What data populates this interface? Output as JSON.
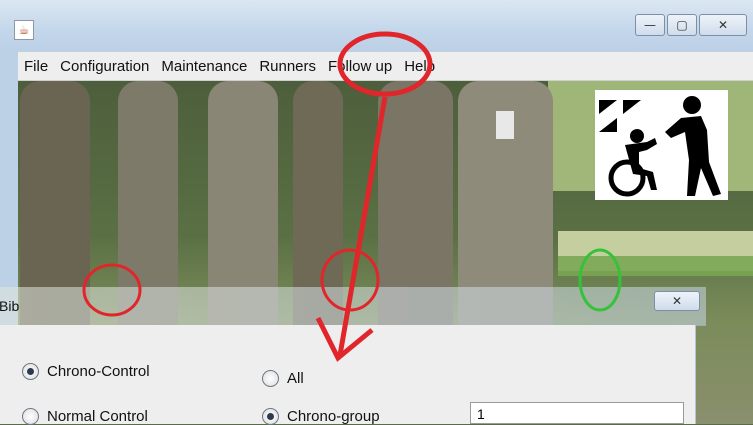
{
  "window": {
    "icon": "java-cup-icon",
    "buttons": {
      "minimize": "—",
      "maximize": "▢",
      "close": "✕"
    }
  },
  "menu": [
    "File",
    "Configuration",
    "Maintenance",
    "Runners",
    "Follow up",
    "Help"
  ],
  "dialog": {
    "title": "Bib",
    "close": "✕",
    "options": {
      "chrono_control": "Chrono-Control",
      "normal_control": "Normal Control",
      "all": "All",
      "chrono_group": "Chrono-group"
    },
    "selected": [
      "Chrono-Control",
      "Chrono-group"
    ],
    "group_value": "1"
  },
  "colors": {
    "annotation_red": "#e0262b",
    "annotation_green": "#35c23a"
  }
}
